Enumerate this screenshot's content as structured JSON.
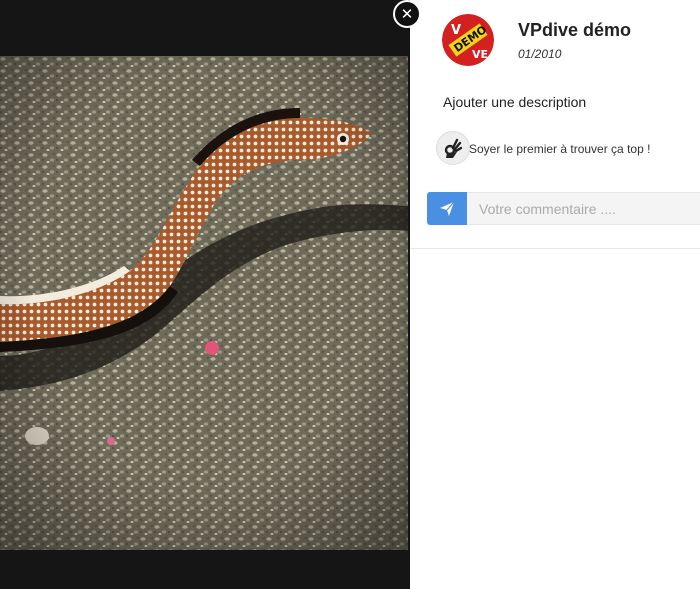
{
  "viewer": {
    "close_label": "✕"
  },
  "photo": {
    "subject_icon": "eel-photo"
  },
  "post": {
    "author_name": "VPdive démo",
    "date": "01/2010",
    "avatar_text": "DEMO",
    "avatar_letters": "VE",
    "add_description": "Ajouter une description",
    "like_prompt": "Soyer le premier à trouver ça top !"
  },
  "comment": {
    "placeholder": "Votre commentaire ...."
  },
  "colors": {
    "accent": "#4a90e2",
    "avatar_red": "#d32020",
    "avatar_yellow": "#f7d417"
  }
}
